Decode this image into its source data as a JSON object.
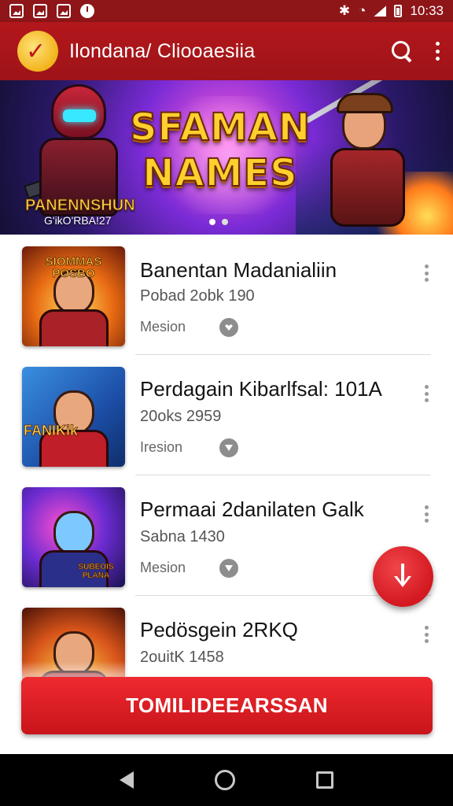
{
  "status_bar": {
    "time": "10:33"
  },
  "app_bar": {
    "title": "Ilondana/ Cliooaesiia"
  },
  "banner": {
    "title_line1": "SFAMAN",
    "title_line2": "NAMES",
    "caption": "PANENNSHUN",
    "caption2": "G'ikO'RBA!27",
    "active_slide": 1,
    "slide_count": 2
  },
  "list": {
    "items": [
      {
        "title": "Banentan Madanialiin",
        "subtitle": "Pobad 2obk 190",
        "meta": "Mesion",
        "thumb_text": "SIOMMAS POSBO",
        "icon": "heart-icon"
      },
      {
        "title": "Perdagain Kibarlfsal: 101A",
        "subtitle": "20oks 2959",
        "meta": "Iresion",
        "thumb_text": "FANIKik",
        "icon": "download-icon"
      },
      {
        "title": "Permaai 2danilaten Galk",
        "subtitle": "Sabna 1430",
        "meta": "Mesion",
        "thumb_text": "SUBEOIS PLANA",
        "icon": "download-icon"
      },
      {
        "title": "Pedösgein 2RKQ",
        "subtitle": "2ouitK 1458",
        "meta": "",
        "thumb_text": "",
        "icon": ""
      }
    ]
  },
  "cta": {
    "label": "TOMILIDEEARSSAN"
  },
  "colors": {
    "primary": "#b3171c",
    "accent": "#d31820",
    "status_bar": "#8e1518"
  }
}
